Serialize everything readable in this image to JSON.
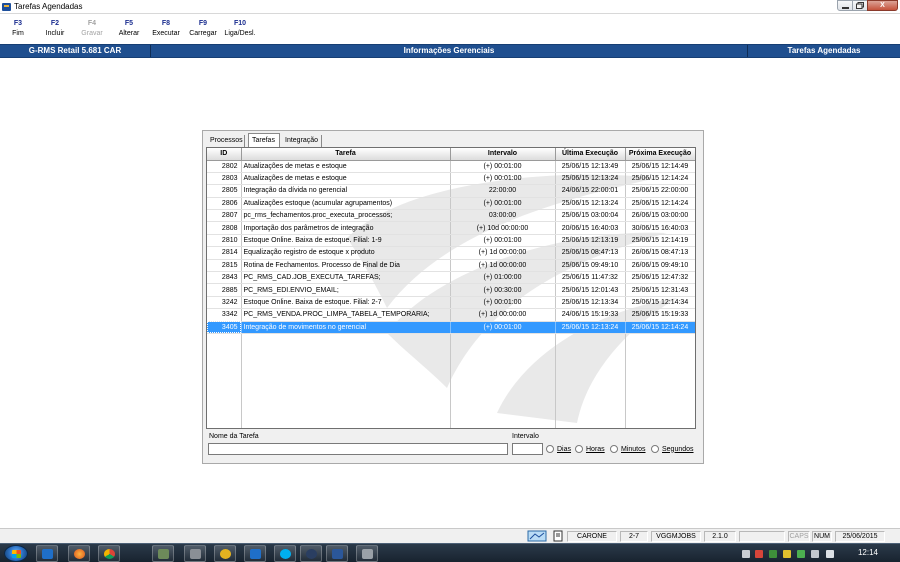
{
  "window": {
    "title": "Tarefas Agendadas",
    "min_label": "0",
    "max_label": "1",
    "close_label": "X"
  },
  "fkeys": [
    {
      "key": "F3",
      "label": "Fim",
      "enabled": true
    },
    {
      "key": "F2",
      "label": "Incluir",
      "enabled": true
    },
    {
      "key": "F4",
      "label": "Gravar",
      "enabled": false
    },
    {
      "key": "F5",
      "label": "Alterar",
      "enabled": true
    },
    {
      "key": "F8",
      "label": "Executar",
      "enabled": true
    },
    {
      "key": "F9",
      "label": "Carregar",
      "enabled": true
    },
    {
      "key": "F10",
      "label": "Liga/Desl.",
      "enabled": true
    }
  ],
  "infobar": {
    "product": "G-RMS Retail 5.681 CAR",
    "section": "Informações Gerenciais",
    "screen": "Tarefas Agendadas"
  },
  "tabs": [
    {
      "label": "Processos",
      "active": false
    },
    {
      "label": "Tarefas",
      "active": true
    },
    {
      "label": "Integração",
      "active": false
    }
  ],
  "grid": {
    "columns": [
      "ID",
      "Tarefa",
      "Intervalo",
      "Última Execução",
      "Próxima Execução"
    ],
    "rows": [
      {
        "id": "2802",
        "tarefa": "Atualizações de metas e estoque",
        "intervalo": "(+) 00:01:00",
        "ultima": "25/06/15 12:13:49",
        "proxima": "25/06/15 12:14:49",
        "selected": false
      },
      {
        "id": "2803",
        "tarefa": "Atualizações de metas e estoque",
        "intervalo": "(+) 00:01:00",
        "ultima": "25/06/15 12:13:24",
        "proxima": "25/06/15 12:14:24",
        "selected": false
      },
      {
        "id": "2805",
        "tarefa": "Integração da dívida no gerencial",
        "intervalo": "22:00:00",
        "ultima": "24/06/15 22:00:01",
        "proxima": "25/06/15 22:00:00",
        "selected": false
      },
      {
        "id": "2806",
        "tarefa": "Atualizações estoque (acumular agrupamentos)",
        "intervalo": "(+) 00:01:00",
        "ultima": "25/06/15 12:13:24",
        "proxima": "25/06/15 12:14:24",
        "selected": false
      },
      {
        "id": "2807",
        "tarefa": "pc_rms_fechamentos.proc_executa_processos;",
        "intervalo": "03:00:00",
        "ultima": "25/06/15 03:00:04",
        "proxima": "26/06/15 03:00:00",
        "selected": false
      },
      {
        "id": "2808",
        "tarefa": "Importação dos parâmetros de integração",
        "intervalo": "(+) 10d 00:00:00",
        "ultima": "20/06/15 16:40:03",
        "proxima": "30/06/15 16:40:03",
        "selected": false
      },
      {
        "id": "2810",
        "tarefa": "Estoque Online. Baixa de estoque. Filial: 1-9",
        "intervalo": "(+) 00:01:00",
        "ultima": "25/06/15 12:13:19",
        "proxima": "25/06/15 12:14:19",
        "selected": false
      },
      {
        "id": "2814",
        "tarefa": "Equalização registro de estoque x produto",
        "intervalo": "(+) 1d 00:00:00",
        "ultima": "25/06/15 08:47:13",
        "proxima": "26/06/15 08:47:13",
        "selected": false
      },
      {
        "id": "2815",
        "tarefa": "Rotina de Fechamentos. Processo de Final de Dia",
        "intervalo": "(+) 1d 00:00:00",
        "ultima": "25/06/15 09:49:10",
        "proxima": "26/06/15 09:49:10",
        "selected": false
      },
      {
        "id": "2843",
        "tarefa": "PC_RMS_CAD.JOB_EXECUTA_TAREFAS;",
        "intervalo": "(+) 01:00:00",
        "ultima": "25/06/15 11:47:32",
        "proxima": "25/06/15 12:47:32",
        "selected": false
      },
      {
        "id": "2885",
        "tarefa": "PC_RMS_EDI.ENVIO_EMAIL;",
        "intervalo": "(+) 00:30:00",
        "ultima": "25/06/15 12:01:43",
        "proxima": "25/06/15 12:31:43",
        "selected": false
      },
      {
        "id": "3242",
        "tarefa": "Estoque Online. Baixa de estoque. Filial: 2-7",
        "intervalo": "(+) 00:01:00",
        "ultima": "25/06/15 12:13:34",
        "proxima": "25/06/15 12:14:34",
        "selected": false
      },
      {
        "id": "3342",
        "tarefa": "PC_RMS_VENDA.PROC_LIMPA_TABELA_TEMPORARIA;",
        "intervalo": "(+) 1d 00:00:00",
        "ultima": "24/06/15 15:19:33",
        "proxima": "25/06/15 15:19:33",
        "selected": false
      },
      {
        "id": "3405",
        "tarefa": "Integração de movimentos no gerencial",
        "intervalo": "(+) 00:01:00",
        "ultima": "25/06/15 12:13:24",
        "proxima": "25/06/15 12:14:24",
        "selected": true
      }
    ]
  },
  "form": {
    "nome_label": "Nome da Tarefa",
    "nome_value": "",
    "intervalo_label": "Intervalo",
    "intervalo_value": "",
    "radios": [
      "Dias",
      "Horas",
      "Minutos",
      "Segundos"
    ]
  },
  "statusbar": {
    "user": "CARONE",
    "filial": "2-7",
    "module": "VGGMJOBS",
    "version": "2.1.0",
    "caps": "CAPS",
    "num": "NUM",
    "date": "25/06/2015"
  },
  "taskbar": {
    "clock": "12:14",
    "accent": "#1f4f8f",
    "selection": "#3399ff"
  }
}
